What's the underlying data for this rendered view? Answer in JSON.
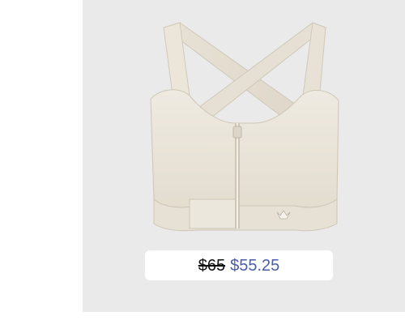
{
  "product": {
    "image_icon": "sports-bra-product-image",
    "price": {
      "original": "$65",
      "sale": "$55.25"
    },
    "colors": {
      "card_background": "#eaeaea",
      "garment": "#ebe6db",
      "sale_price": "#4a5ea8",
      "original_price": "#111111"
    }
  }
}
